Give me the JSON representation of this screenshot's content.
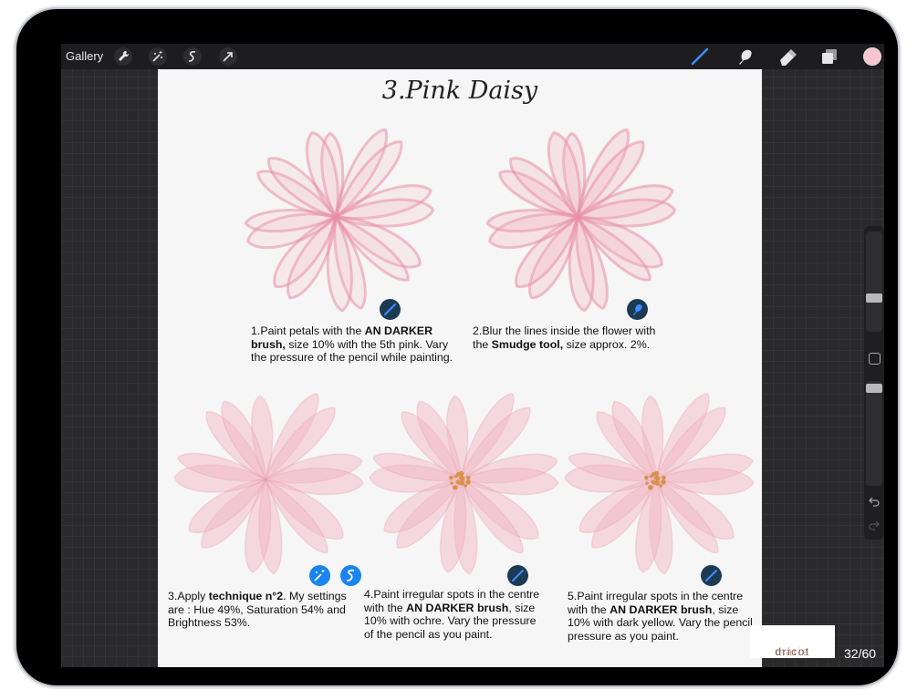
{
  "toolbar": {
    "gallery_label": "Gallery",
    "left_tools": [
      "wrench-icon",
      "magic-wand-icon",
      "selection-s-icon",
      "transform-arrow-icon"
    ],
    "right_tools": [
      "brush-icon",
      "smudge-icon",
      "eraser-icon",
      "layers-icon"
    ],
    "current_color": "#f7c4d2"
  },
  "page": {
    "title": "3.Pink Daisy",
    "steps": [
      {
        "line1": "1.Paint petals with the ",
        "bold1": "AN DARKER",
        "line1b": "",
        "bold2": "brush,",
        "rest": " size 10% with the 5th pink. Vary the pressure of the pencil while painting."
      },
      {
        "pre": "2.Blur the lines inside the flower with the ",
        "bold": "Smudge tool,",
        "post": " size approx. 2%."
      },
      {
        "pre": "3.Apply ",
        "bold": "technique n°2",
        "post": ". My settings are : Hue 49%, Saturation 54% and Brightness 53%."
      },
      {
        "pre": "4.Paint irregular spots in the centre with the ",
        "bold": "AN DARKER brush",
        "post": ", size 10% with ochre. Vary the pressure of the pencil as you paint."
      },
      {
        "pre": "5.Paint irregular spots in the centre with the ",
        "bold": "AN DARKER brush",
        "post": ", size 10% with dark yellow. Vary the pencil pressure as you paint."
      }
    ],
    "logo": {
      "first": "marie",
      "second": "dricot"
    },
    "page_number": "32/60"
  },
  "colors": {
    "petal": "#f2b3c1",
    "petal_dark": "#e88fa6",
    "ochre_spots": "#d8924a",
    "badge_dark": "#1d3a55",
    "badge_blue": "#1a84f1"
  }
}
